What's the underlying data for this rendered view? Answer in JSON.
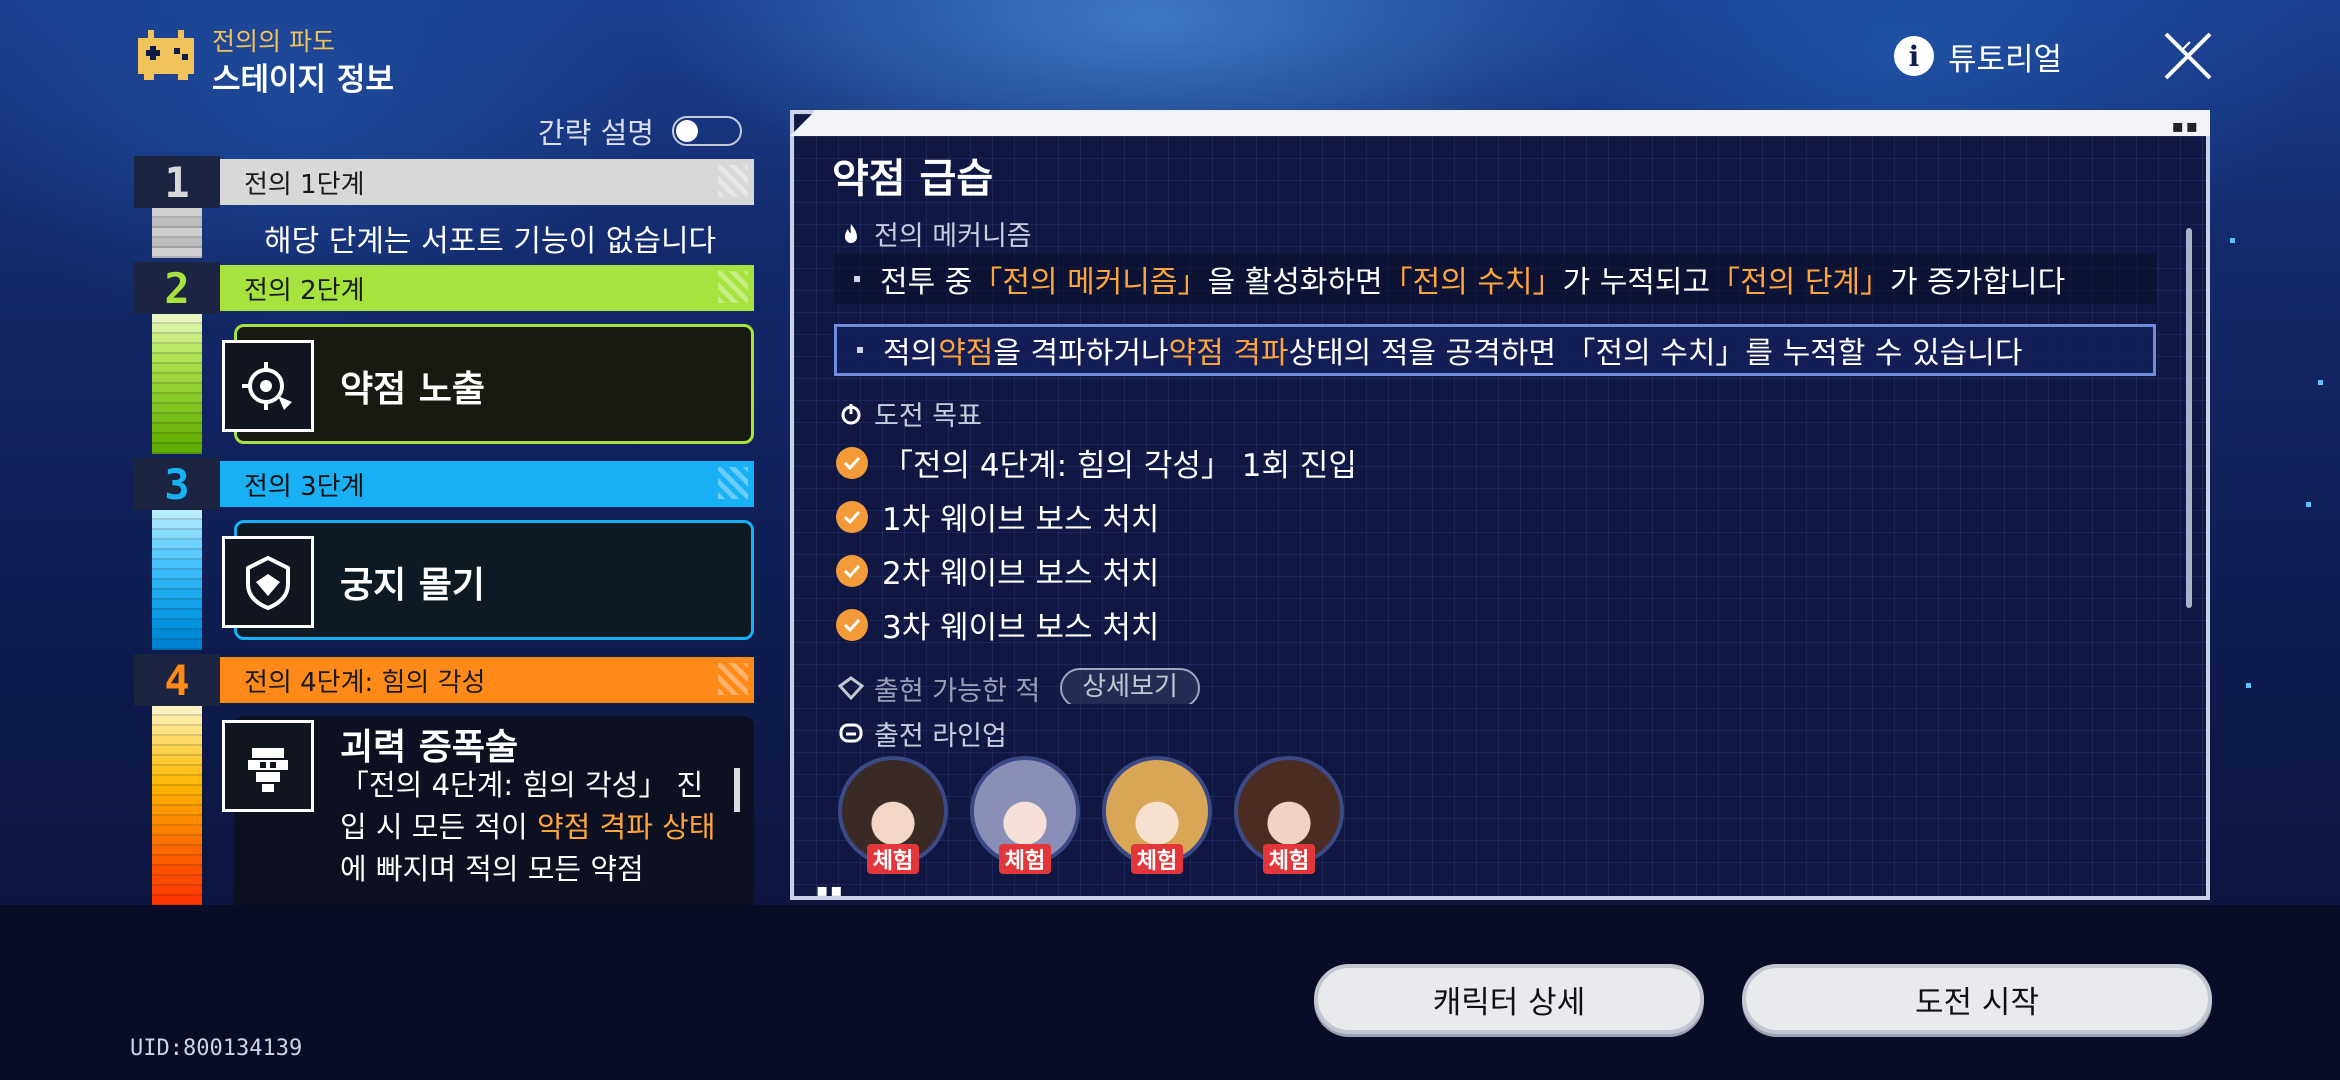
{
  "header": {
    "subtitle": "전의의 파도",
    "title": "스테이지 정보",
    "tutorial_label": "튜토리얼"
  },
  "brief_toggle": {
    "label": "간략 설명",
    "on": false
  },
  "stages": [
    {
      "num": "1",
      "label": "전의 1단계",
      "color": "#d8d8d8",
      "text_color": "#1a1a1a",
      "note": "해당 단계는 서포트 기능이 없습니다"
    },
    {
      "num": "2",
      "label": "전의 2단계",
      "color": "#a6e33f",
      "text_color": "#1a1a1a",
      "skill": "약점 노출",
      "icon": "crosshair-icon"
    },
    {
      "num": "3",
      "label": "전의 3단계",
      "color": "#1ab0f5",
      "text_color": "#111111",
      "skill": "궁지 몰기",
      "icon": "shield-hand-icon"
    },
    {
      "num": "4",
      "label": "전의 4단계: 힘의 각성",
      "color": "#ff8a1a",
      "text_color": "#1a1a1a",
      "skill": "괴력 증폭술",
      "icon": "power-icon",
      "desc_a": "「전의 4단계: 힘의 각성」 진입 시 모든 적이 ",
      "desc_hl": "약점 격파 상태",
      "desc_b": "에 빠지며 적의 모든 약점"
    }
  ],
  "panel": {
    "title": "약점 급습",
    "mechanism_heading": "전의 메커니즘",
    "line1": {
      "a": "전투 중 ",
      "q1": "「전의 메커니즘」",
      "b": "을 활성화하면 ",
      "q2": "「전의 수치」",
      "c": "가 누적되고 ",
      "q3": "「전의 단계」",
      "d": "가 증가합니다"
    },
    "line2": {
      "a": "적의 ",
      "q1": "약점",
      "b": "을 격파하거나 ",
      "q2": "약점 격파",
      "c": " 상태의 적을 공격하면 「전의 수치」를 누적할 수 있습니다"
    },
    "goals_heading": "도전 목표",
    "goals": [
      "「전의 4단계: 힘의 각성」 1회 진입",
      "1차 웨이브 보스 처치",
      "2차 웨이브 보스 처치",
      "3차 웨이브 보스 처치"
    ],
    "enemies_heading": "출현 가능한 적",
    "detail_button": "상세보기",
    "lineup_heading": "출전 라인업",
    "lineup": [
      {
        "badge": "체험",
        "hair": "#3a2a26"
      },
      {
        "badge": "체험",
        "hair": "#8a8fb8"
      },
      {
        "badge": "체험",
        "hair": "#d9a657"
      },
      {
        "badge": "체험",
        "hair": "#4a2c22"
      }
    ]
  },
  "footer": {
    "uid": "UID:800134139",
    "character_detail_button": "캐릭터 상세",
    "start_button": "도전 시작"
  }
}
